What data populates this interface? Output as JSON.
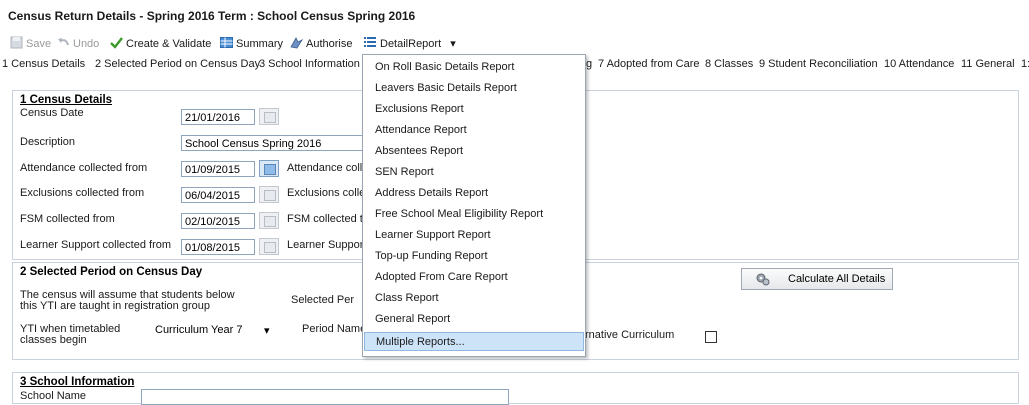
{
  "window": {
    "title": "Census Return Details - Spring 2016 Term : School Census Spring 2016"
  },
  "toolbar": {
    "save": "Save",
    "undo": "Undo",
    "create_validate": "Create & Validate",
    "summary": "Summary",
    "authorise": "Authorise",
    "detail_report": "DetailReport",
    "dropdown_arrow": "▾"
  },
  "tabs": {
    "t1": "1 Census Details",
    "t2": "2 Selected Period on Census Day",
    "t3": "3 School Information",
    "t3b": "g",
    "t7": "7 Adopted from Care",
    "t8": "8 Classes",
    "t9": "9 Student Reconciliation",
    "t10": "10 Attendance",
    "t11": "11 General",
    "t12": "1:"
  },
  "census_details": {
    "title": "1 Census Details",
    "census_date_label": "Census Date",
    "census_date": "21/01/2016",
    "description_label": "Description",
    "description": "School Census Spring 2016",
    "attendance_from_label": "Attendance collected from",
    "attendance_from": "01/09/2015",
    "attendance_to_label": "Attendance colle",
    "exclusions_from_label": "Exclusions collected from",
    "exclusions_from": "06/04/2015",
    "exclusions_to_label": "Exclusions colle",
    "fsm_from_label": "FSM collected from",
    "fsm_from": "02/10/2015",
    "fsm_to_label": "FSM collected to",
    "learner_from_label": "Learner Support collected from",
    "learner_from": "01/08/2015",
    "learner_to_label": "Learner Support"
  },
  "selected_period": {
    "title": "2 Selected Period on Census Day",
    "assume_line1": "The census will assume that students below",
    "assume_line2": "this YTI are taught in registration group",
    "selected_per_label": "Selected Per",
    "yti_label_line1": "YTI when timetabled",
    "yti_label_line2": "classes begin",
    "yti_value": "Curriculum Year 7",
    "period_name_label": "Period Name",
    "alt_curriculum_label": "rnative Curriculum",
    "calculate_button": "Calculate All Details"
  },
  "school_info": {
    "title": "3 School Information",
    "school_name_label": "School Name"
  },
  "detail_menu": {
    "items": [
      "On Roll Basic Details Report",
      "Leavers Basic Details Report",
      "Exclusions Report",
      "Attendance Report",
      "Absentees Report",
      "SEN Report",
      "Address Details Report",
      "Free School Meal Eligibility Report",
      "Learner Support Report",
      "Top-up Funding Report",
      "Adopted From Care Report",
      "Class Report",
      "General Report",
      "Multiple Reports..."
    ],
    "highlighted": "Multiple Reports..."
  },
  "colors": {
    "menu_highlight": "#cde3f8",
    "field_border": "#8fa5bd",
    "panel_border": "#c9d2de"
  }
}
